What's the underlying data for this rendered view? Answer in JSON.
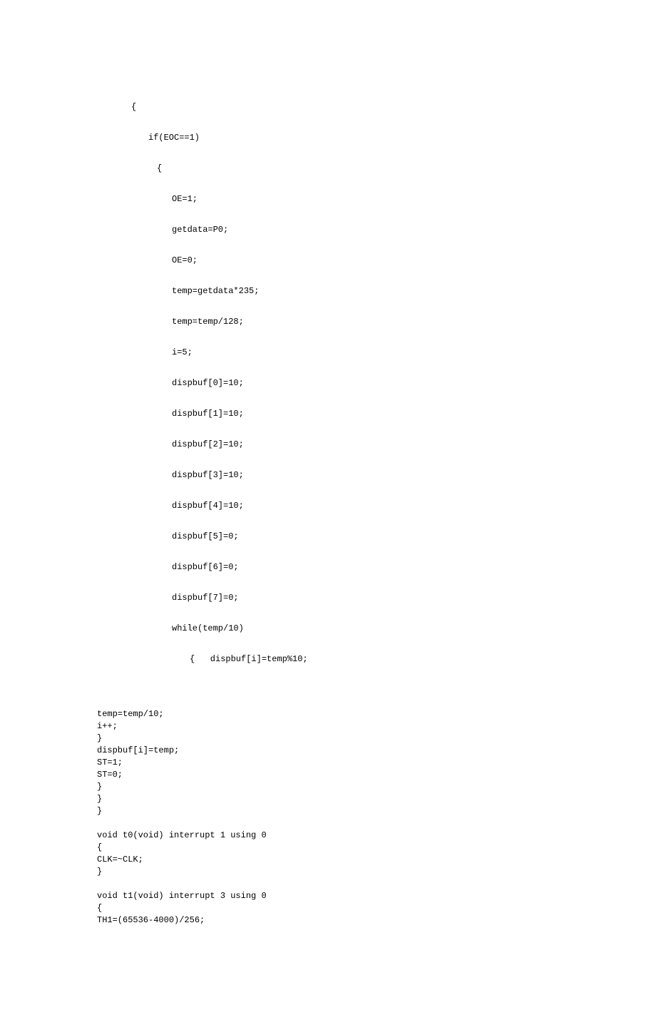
{
  "code": {
    "spaced": [
      {
        "text": "{",
        "indent": "indent-2"
      },
      {
        "text": "if(EOC==1)",
        "indent": "indent-3"
      },
      {
        "text": "{",
        "indent": "indent-3b"
      },
      {
        "text": "OE=1;",
        "indent": "indent-4"
      },
      {
        "text": "getdata=P0;",
        "indent": "indent-4"
      },
      {
        "text": "OE=0;",
        "indent": "indent-4"
      },
      {
        "text": "temp=getdata*235;",
        "indent": "indent-4"
      },
      {
        "text": "temp=temp/128;",
        "indent": "indent-4"
      },
      {
        "text": "i=5;",
        "indent": "indent-4"
      },
      {
        "text": "dispbuf[0]=10;",
        "indent": "indent-4"
      },
      {
        "text": "dispbuf[1]=10;",
        "indent": "indent-4"
      },
      {
        "text": "dispbuf[2]=10;",
        "indent": "indent-4"
      },
      {
        "text": "dispbuf[3]=10;",
        "indent": "indent-4"
      },
      {
        "text": "dispbuf[4]=10;",
        "indent": "indent-4"
      },
      {
        "text": "dispbuf[5]=0;",
        "indent": "indent-4"
      },
      {
        "text": "dispbuf[6]=0;",
        "indent": "indent-4"
      },
      {
        "text": "dispbuf[7]=0;",
        "indent": "indent-4"
      },
      {
        "text": "while(temp/10)",
        "indent": "indent-4"
      },
      {
        "text": "{   dispbuf[i]=temp%10;",
        "indent": "indent-5"
      }
    ],
    "tight": [
      {
        "text": "temp=temp/10;",
        "indent": ""
      },
      {
        "text": "i++;",
        "indent": ""
      },
      {
        "text": "}",
        "indent": ""
      },
      {
        "text": "dispbuf[i]=temp;",
        "indent": ""
      },
      {
        "text": "ST=1;",
        "indent": ""
      },
      {
        "text": "ST=0;",
        "indent": ""
      },
      {
        "text": "}",
        "indent": ""
      },
      {
        "text": "}",
        "indent": ""
      },
      {
        "text": "}",
        "indent": ""
      },
      {
        "text": "",
        "indent": ""
      },
      {
        "text": "void t0(void) interrupt 1 using 0",
        "indent": ""
      },
      {
        "text": "{",
        "indent": ""
      },
      {
        "text": "CLK=~CLK;",
        "indent": ""
      },
      {
        "text": "}",
        "indent": ""
      },
      {
        "text": "",
        "indent": ""
      },
      {
        "text": "void t1(void) interrupt 3 using 0",
        "indent": ""
      },
      {
        "text": "{",
        "indent": ""
      },
      {
        "text": "TH1=(65536-4000)/256;",
        "indent": ""
      }
    ]
  }
}
